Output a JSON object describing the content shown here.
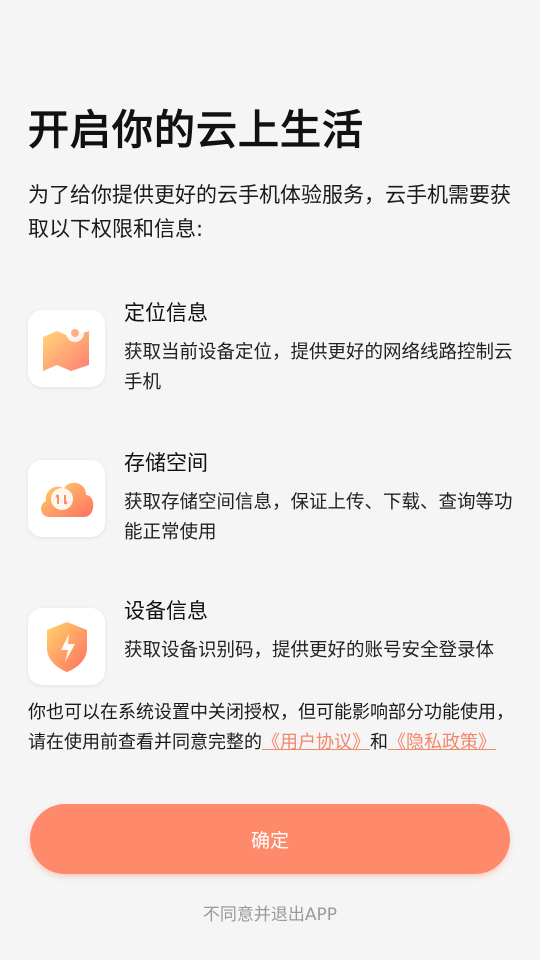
{
  "header": {
    "title": "开启你的云上生活",
    "intro": "为了给你提供更好的云手机体验服务，云手机需要获取以下权限和信息:"
  },
  "permissions": [
    {
      "icon": "location-map-icon",
      "title": "定位信息",
      "desc": "获取当前设备定位，提供更好的网络线路控制云手机"
    },
    {
      "icon": "cloud-storage-icon",
      "title": "存储空间",
      "desc": "获取存储空间信息，保证上传、下载、查询等功能正常使用"
    },
    {
      "icon": "security-shield-icon",
      "title": "设备信息",
      "desc": "获取设备识别码，提供更好的账号安全登录体"
    }
  ],
  "notice": {
    "text_before": "你也可以在系统设置中关闭授权，但可能影响部分功能使用，请在使用前查看并同意完整的",
    "user_agreement": "《用户协议》",
    "and": "和",
    "privacy_policy": "《隐私政策》"
  },
  "actions": {
    "confirm_label": "确定",
    "decline_label": "不同意并退出APP"
  },
  "colors": {
    "accent": "#ff8a6b",
    "link": "#f2876b",
    "background": "#f5f5f5"
  }
}
